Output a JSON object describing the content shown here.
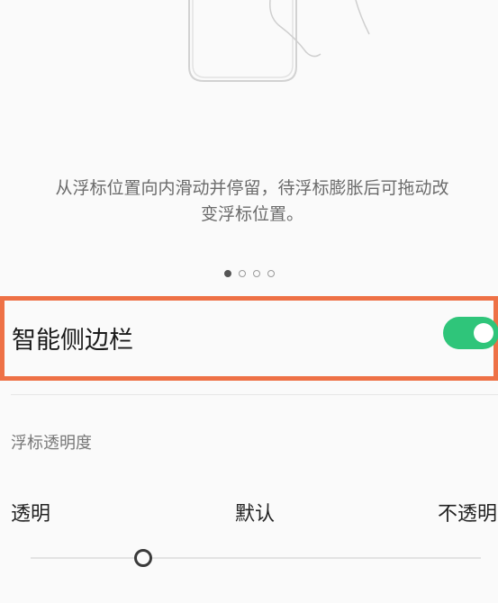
{
  "tutorial": {
    "description_line1": "从浮标位置向内滑动并停留，待浮标膨胀后可拖动改",
    "description_line2": "变浮标位置。",
    "pager": {
      "total_pages": 4,
      "current_page": 1
    }
  },
  "smart_sidebar": {
    "label": "智能侧边栏",
    "enabled": true,
    "toggle_color": "#2fc57a"
  },
  "highlight_color": "#ee7146",
  "float_opacity": {
    "title": "浮标透明度",
    "scale_labels": [
      "透明",
      "默认",
      "不透明"
    ],
    "slider_value_fraction": 0.25
  },
  "icons": {
    "illustration": "phone-hand-illustration",
    "toggle": "toggle-switch",
    "slider_thumb": "slider-thumb"
  }
}
